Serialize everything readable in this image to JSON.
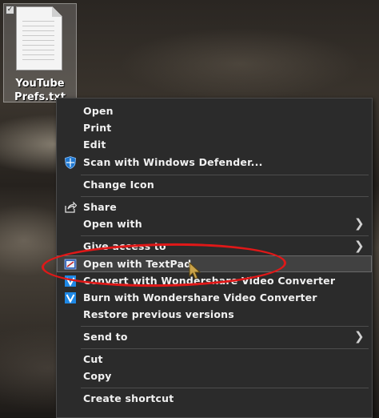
{
  "desktop": {
    "file": {
      "name_line1": "YouTube",
      "name_line2": "Prefs.txt",
      "icon": "text-document-icon",
      "selected": true
    }
  },
  "context_menu": {
    "items": {
      "open": {
        "label": "Open"
      },
      "print": {
        "label": "Print"
      },
      "edit": {
        "label": "Edit"
      },
      "scan": {
        "label": "Scan with Windows Defender...",
        "icon": "windows-defender-shield-icon"
      },
      "change_icon": {
        "label": "Change Icon"
      },
      "share": {
        "label": "Share",
        "icon": "share-icon"
      },
      "open_with": {
        "label": "Open with",
        "submenu": true
      },
      "give_access": {
        "label": "Give access to",
        "submenu": true
      },
      "open_textpad": {
        "label": "Open with TextPad",
        "icon": "textpad-icon",
        "hovered": true
      },
      "convert_wondershare": {
        "label": "Convert with Wondershare Video Converter",
        "icon": "wondershare-icon"
      },
      "burn_wondershare": {
        "label": "Burn with Wondershare Video Converter",
        "icon": "wondershare-icon"
      },
      "restore_versions": {
        "label": "Restore previous versions"
      },
      "send_to": {
        "label": "Send to",
        "submenu": true
      },
      "cut": {
        "label": "Cut"
      },
      "copy": {
        "label": "Copy"
      },
      "create_shortcut": {
        "label": "Create shortcut"
      }
    }
  },
  "annotation": {
    "highlight_color": "#e01818",
    "highlight_target": "open_textpad"
  },
  "colors": {
    "menu_background": "#2b2b2b",
    "menu_text": "#f0f0f0",
    "hover_background": "#414141"
  }
}
